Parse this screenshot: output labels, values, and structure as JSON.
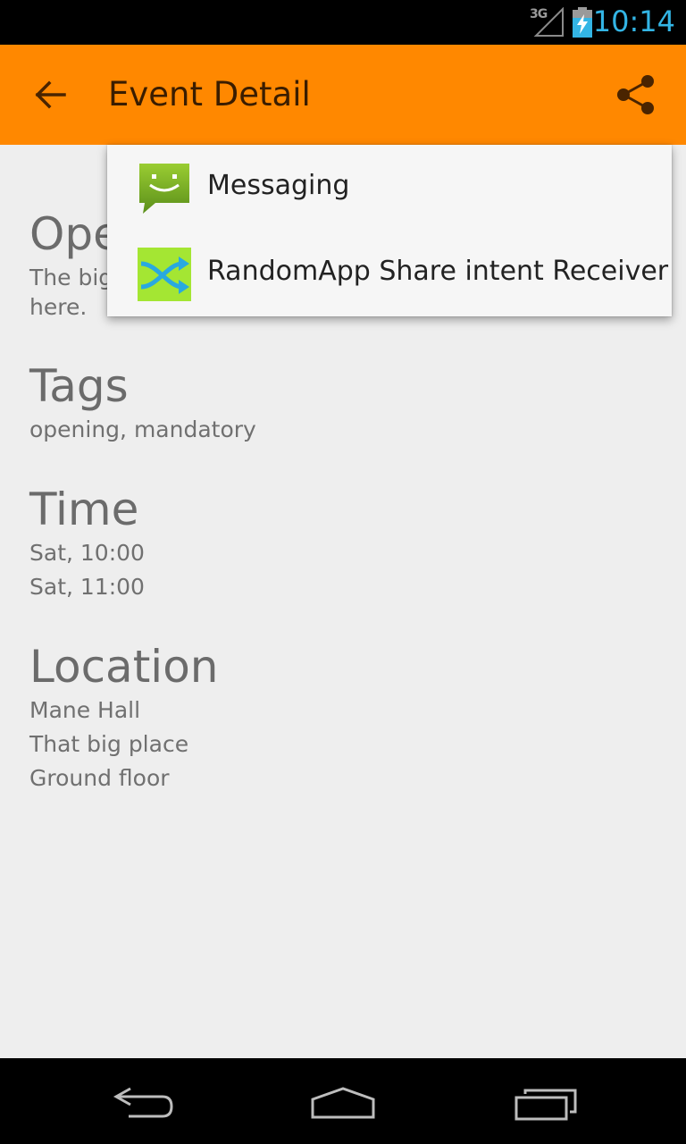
{
  "status_bar": {
    "network": "3G",
    "time": "10:14"
  },
  "action_bar": {
    "title": "Event Detail"
  },
  "share_menu": {
    "items": [
      {
        "label": "Messaging",
        "icon": "messaging-app-icon"
      },
      {
        "label": "RandomApp Share intent Receiver",
        "icon": "shuffle-app-icon"
      }
    ]
  },
  "detail": {
    "opening": {
      "title": "Ope",
      "description_line1": "The big",
      "description_line2": "here."
    },
    "tags": {
      "title": "Tags",
      "value": "opening, mandatory"
    },
    "time": {
      "title": "Time",
      "start": "Sat, 10:00",
      "end": "Sat, 11:00"
    },
    "location": {
      "title": "Location",
      "line1": "Mane Hall",
      "line2": "That big place",
      "line3": "Ground floor"
    }
  },
  "colors": {
    "action_bar": "#ff8800",
    "clock": "#33b5e5",
    "background": "#eeeeee"
  }
}
